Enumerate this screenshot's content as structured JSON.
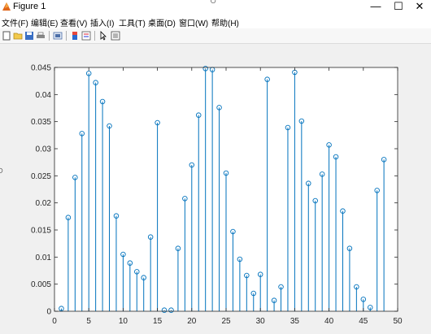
{
  "window": {
    "title": "Figure 1",
    "controls": {
      "minimize": "—",
      "maximize": "☐",
      "close": "✕"
    }
  },
  "menu": {
    "items": [
      "文件(F)",
      "编辑(E)",
      "查看(V)",
      "插入(I)",
      "工具(T)",
      "桌面(D)",
      "窗口(W)",
      "帮助(H)"
    ]
  },
  "toolbar": {
    "icons": [
      "new-figure-icon",
      "open-file-icon",
      "save-icon",
      "print-icon",
      "link-plot-icon",
      "insert-colorbar-icon",
      "insert-legend-icon",
      "edit-plot-arrow-icon",
      "property-inspector-icon"
    ]
  },
  "chart_data": {
    "type": "stem",
    "title": "",
    "xlabel": "",
    "ylabel": "",
    "xlim": [
      0,
      50
    ],
    "ylim": [
      0,
      0.045
    ],
    "xticks": [
      0,
      5,
      10,
      15,
      20,
      25,
      30,
      35,
      40,
      45,
      50
    ],
    "yticks": [
      0,
      0.005,
      0.01,
      0.015,
      0.02,
      0.025,
      0.03,
      0.035,
      0.04,
      0.045
    ],
    "xtick_labels": [
      "0",
      "5",
      "10",
      "15",
      "20",
      "25",
      "30",
      "35",
      "40",
      "45",
      "50"
    ],
    "ytick_labels": [
      "0",
      "0.005",
      "0.01",
      "0.015",
      "0.02",
      "0.025",
      "0.03",
      "0.035",
      "0.04",
      "0.045"
    ],
    "color": "#0072bd",
    "grid": false,
    "x": [
      1,
      2,
      3,
      4,
      5,
      6,
      7,
      8,
      9,
      10,
      11,
      12,
      13,
      14,
      15,
      16,
      17,
      18,
      19,
      20,
      21,
      22,
      23,
      24,
      25,
      26,
      27,
      28,
      29,
      30,
      31,
      32,
      33,
      34,
      35,
      36,
      37,
      38,
      39,
      40,
      41,
      42,
      43,
      44,
      45,
      46,
      47,
      48
    ],
    "y": [
      0.0005,
      0.0173,
      0.0247,
      0.0328,
      0.0439,
      0.0422,
      0.0387,
      0.0342,
      0.0176,
      0.0105,
      0.0089,
      0.0073,
      0.0062,
      0.0137,
      0.0348,
      0.0002,
      0.0002,
      0.0116,
      0.0208,
      0.027,
      0.0362,
      0.0448,
      0.0446,
      0.0376,
      0.0255,
      0.0147,
      0.0096,
      0.0066,
      0.0033,
      0.0068,
      0.0428,
      0.002,
      0.0045,
      0.0339,
      0.0441,
      0.0351,
      0.0236,
      0.0204,
      0.0253,
      0.0307,
      0.0285,
      0.0185,
      0.0116,
      0.0045,
      0.0022,
      0.0007,
      0.0223,
      0.028
    ]
  }
}
